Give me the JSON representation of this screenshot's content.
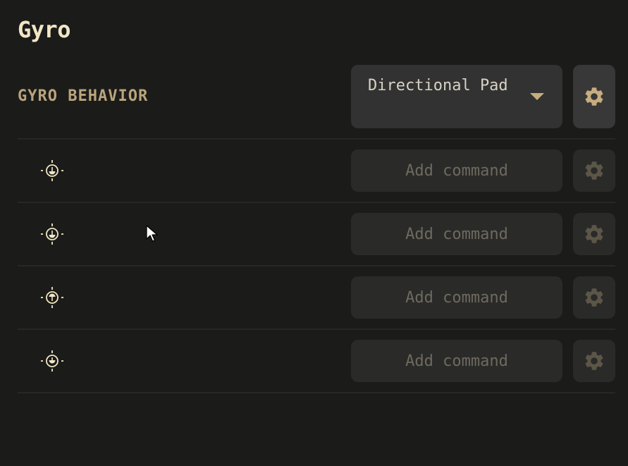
{
  "section": {
    "title": "Gyro"
  },
  "behavior": {
    "label": "GYRO BEHAVIOR",
    "dropdown_value": "Directional Pad",
    "caret_icon": "caret-down-icon",
    "settings_icon": "gear-icon"
  },
  "rows": [
    {
      "icon": "gyro-direction-icon",
      "add_label": "Add command",
      "settings_icon": "gear-icon"
    },
    {
      "icon": "gyro-direction-icon",
      "add_label": "Add command",
      "settings_icon": "gear-icon"
    },
    {
      "icon": "gyro-direction-icon",
      "add_label": "Add command",
      "settings_icon": "gear-icon"
    },
    {
      "icon": "gyro-direction-icon",
      "add_label": "Add command",
      "settings_icon": "gear-icon"
    }
  ],
  "colors": {
    "background": "#1b1b1a",
    "title": "#f2e6c4",
    "label": "#b9a57c",
    "accent": "#c7ad7f",
    "control": "#323232",
    "control_muted": "#2a2a29"
  }
}
